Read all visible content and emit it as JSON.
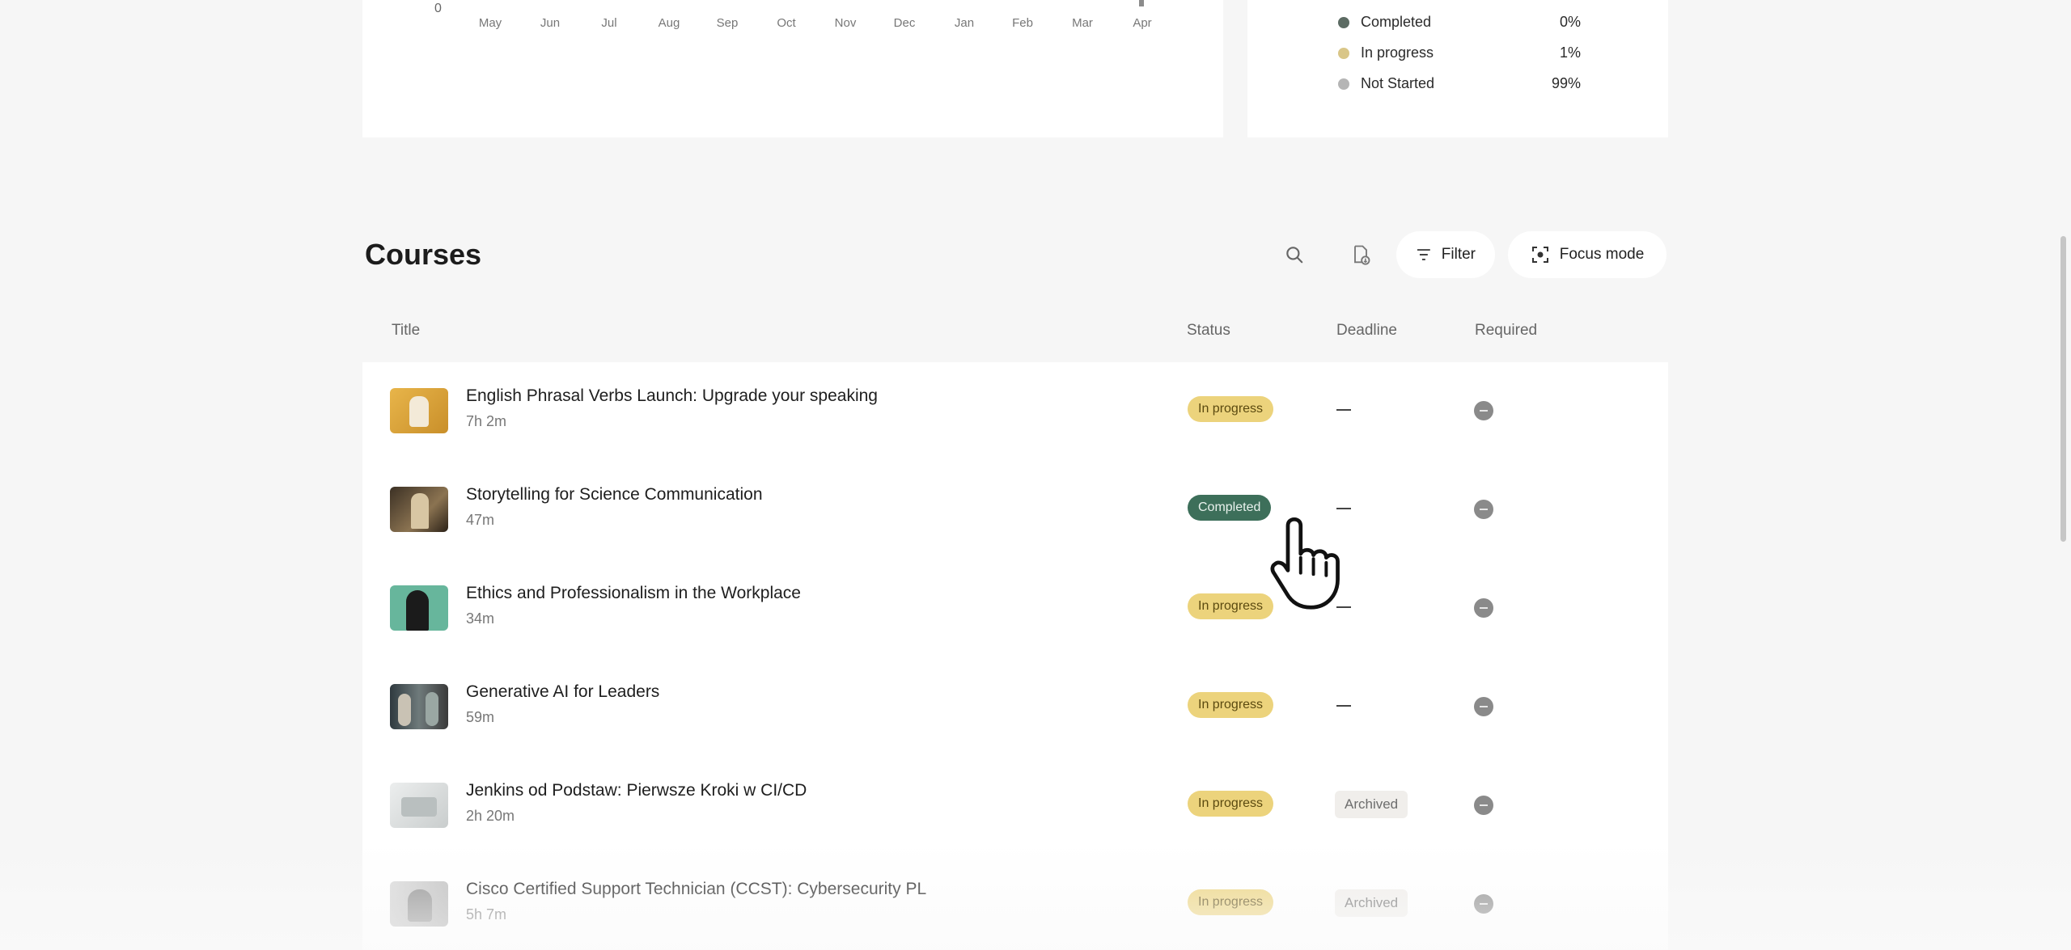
{
  "chart": {
    "y_tick": "0",
    "months": [
      "May",
      "Jun",
      "Jul",
      "Aug",
      "Sep",
      "Oct",
      "Nov",
      "Dec",
      "Jan",
      "Feb",
      "Mar",
      "Apr"
    ]
  },
  "progress_legend": [
    {
      "label": "Completed",
      "value": "0%",
      "color": "#5c6b63"
    },
    {
      "label": "In progress",
      "value": "1%",
      "color": "#d9c688"
    },
    {
      "label": "Not Started",
      "value": "99%",
      "color": "#b5b5b5"
    }
  ],
  "courses": {
    "title": "Courses",
    "toolbar": {
      "filter_label": "Filter",
      "focus_label": "Focus mode"
    },
    "columns": {
      "title": "Title",
      "status": "Status",
      "deadline": "Deadline",
      "required": "Required"
    },
    "rows": [
      {
        "title": "English Phrasal Verbs Launch: Upgrade your speaking",
        "duration": "7h 2m",
        "status": "In progress"
      },
      {
        "title": "Storytelling for Science Communication",
        "duration": "47m",
        "status": "Completed"
      },
      {
        "title": "Ethics and Professionalism in the Workplace",
        "duration": "34m",
        "status": "In progress"
      },
      {
        "title": "Generative AI for Leaders",
        "duration": "59m",
        "status": "In progress"
      },
      {
        "title": "Jenkins od Podstaw: Pierwsze Kroki w CI/CD",
        "duration": "2h 20m",
        "status": "In progress",
        "deadline": "Archived"
      },
      {
        "title": "Cisco Certified Support Technician (CCST): Cybersecurity PL",
        "duration": "5h 7m",
        "status": "In progress",
        "deadline": "Archived"
      }
    ]
  },
  "colors": {
    "in_progress": "#ecd37c",
    "completed": "#3d6f5a",
    "accent_background": "#f6f6f6"
  }
}
